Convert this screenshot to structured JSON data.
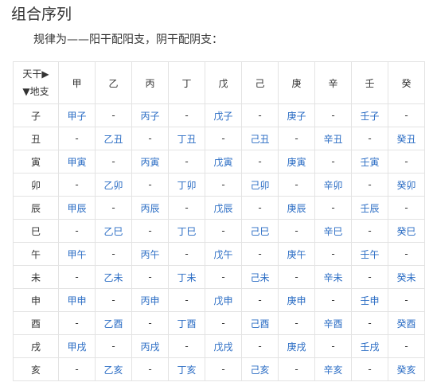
{
  "heading": "组合序列",
  "intro": "规律为——阳干配阳支，阴干配阴支：",
  "table": {
    "corner_top": "天干▶",
    "corner_bottom": "▼地支",
    "stems": [
      "甲",
      "乙",
      "丙",
      "丁",
      "戊",
      "己",
      "庚",
      "辛",
      "壬",
      "癸"
    ],
    "rows": [
      {
        "branch": "子",
        "cells": [
          "甲子",
          "-",
          "丙子",
          "-",
          "戊子",
          "-",
          "庚子",
          "-",
          "壬子",
          "-"
        ]
      },
      {
        "branch": "丑",
        "cells": [
          "-",
          "乙丑",
          "-",
          "丁丑",
          "-",
          "己丑",
          "-",
          "辛丑",
          "-",
          "癸丑"
        ]
      },
      {
        "branch": "寅",
        "cells": [
          "甲寅",
          "-",
          "丙寅",
          "-",
          "戊寅",
          "-",
          "庚寅",
          "-",
          "壬寅",
          "-"
        ]
      },
      {
        "branch": "卯",
        "cells": [
          "-",
          "乙卯",
          "-",
          "丁卯",
          "-",
          "己卯",
          "-",
          "辛卯",
          "-",
          "癸卯"
        ]
      },
      {
        "branch": "辰",
        "cells": [
          "甲辰",
          "-",
          "丙辰",
          "-",
          "戊辰",
          "-",
          "庚辰",
          "-",
          "壬辰",
          "-"
        ]
      },
      {
        "branch": "巳",
        "cells": [
          "-",
          "乙巳",
          "-",
          "丁巳",
          "-",
          "己巳",
          "-",
          "辛巳",
          "-",
          "癸巳"
        ]
      },
      {
        "branch": "午",
        "cells": [
          "甲午",
          "-",
          "丙午",
          "-",
          "戊午",
          "-",
          "庚午",
          "-",
          "壬午",
          "-"
        ]
      },
      {
        "branch": "未",
        "cells": [
          "-",
          "乙未",
          "-",
          "丁未",
          "-",
          "己未",
          "-",
          "辛未",
          "-",
          "癸未"
        ]
      },
      {
        "branch": "申",
        "cells": [
          "甲申",
          "-",
          "丙申",
          "-",
          "戊申",
          "-",
          "庚申",
          "-",
          "壬申",
          "-"
        ]
      },
      {
        "branch": "酉",
        "cells": [
          "-",
          "乙酉",
          "-",
          "丁酉",
          "-",
          "己酉",
          "-",
          "辛酉",
          "-",
          "癸酉"
        ]
      },
      {
        "branch": "戌",
        "cells": [
          "甲戌",
          "-",
          "丙戌",
          "-",
          "戊戌",
          "-",
          "庚戌",
          "-",
          "壬戌",
          "-"
        ]
      },
      {
        "branch": "亥",
        "cells": [
          "-",
          "乙亥",
          "-",
          "丁亥",
          "-",
          "己亥",
          "-",
          "辛亥",
          "-",
          "癸亥"
        ]
      }
    ]
  },
  "colors": {
    "combo_text": "#2a6cc4",
    "plain_text": "#333333",
    "border": "#e3e3e3"
  }
}
